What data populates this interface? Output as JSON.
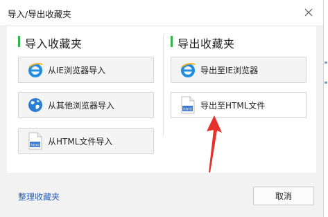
{
  "dialog": {
    "title": "导入/导出收藏夹"
  },
  "import_section": {
    "title": "导入收藏夹",
    "buttons": [
      {
        "label": "从IE浏览器导入",
        "icon": "ie-icon"
      },
      {
        "label": "从其他浏览器导入",
        "icon": "globe-icon"
      },
      {
        "label": "从HTML文件导入",
        "icon": "html-file-icon"
      }
    ]
  },
  "export_section": {
    "title": "导出收藏夹",
    "buttons": [
      {
        "label": "导出至IE浏览器",
        "icon": "ie-icon"
      },
      {
        "label": "导出至HTML文件",
        "icon": "html-file-icon"
      }
    ]
  },
  "footer": {
    "manage_link": "整理收藏夹",
    "cancel_label": "取消"
  },
  "file_icon_text": "html",
  "colors": {
    "accent_green": "#33b14a",
    "link_blue": "#2a62b8",
    "arrow_red": "#e5322d"
  }
}
